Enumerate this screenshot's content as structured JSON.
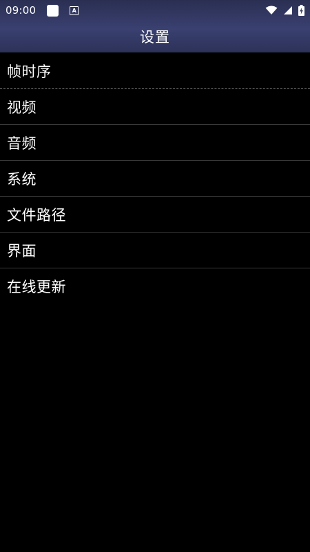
{
  "status_bar": {
    "time": "09:00",
    "notif_a": "A",
    "icons": [
      "notification-square-icon",
      "a-notification-icon",
      "wifi-icon",
      "signal-icon",
      "battery-charging-icon"
    ],
    "color": "#ffffff"
  },
  "header": {
    "title": "设置",
    "background_top": "#2a2f52",
    "background_mid": "#3a4070"
  },
  "menu": {
    "items": [
      {
        "label": "帧时序"
      },
      {
        "label": "视频"
      },
      {
        "label": "音频"
      },
      {
        "label": "系统"
      },
      {
        "label": "文件路径"
      },
      {
        "label": "界面"
      },
      {
        "label": "在线更新"
      }
    ],
    "text_color": "#ffffff",
    "divider_color": "#3a3a3a",
    "background": "#000000"
  }
}
